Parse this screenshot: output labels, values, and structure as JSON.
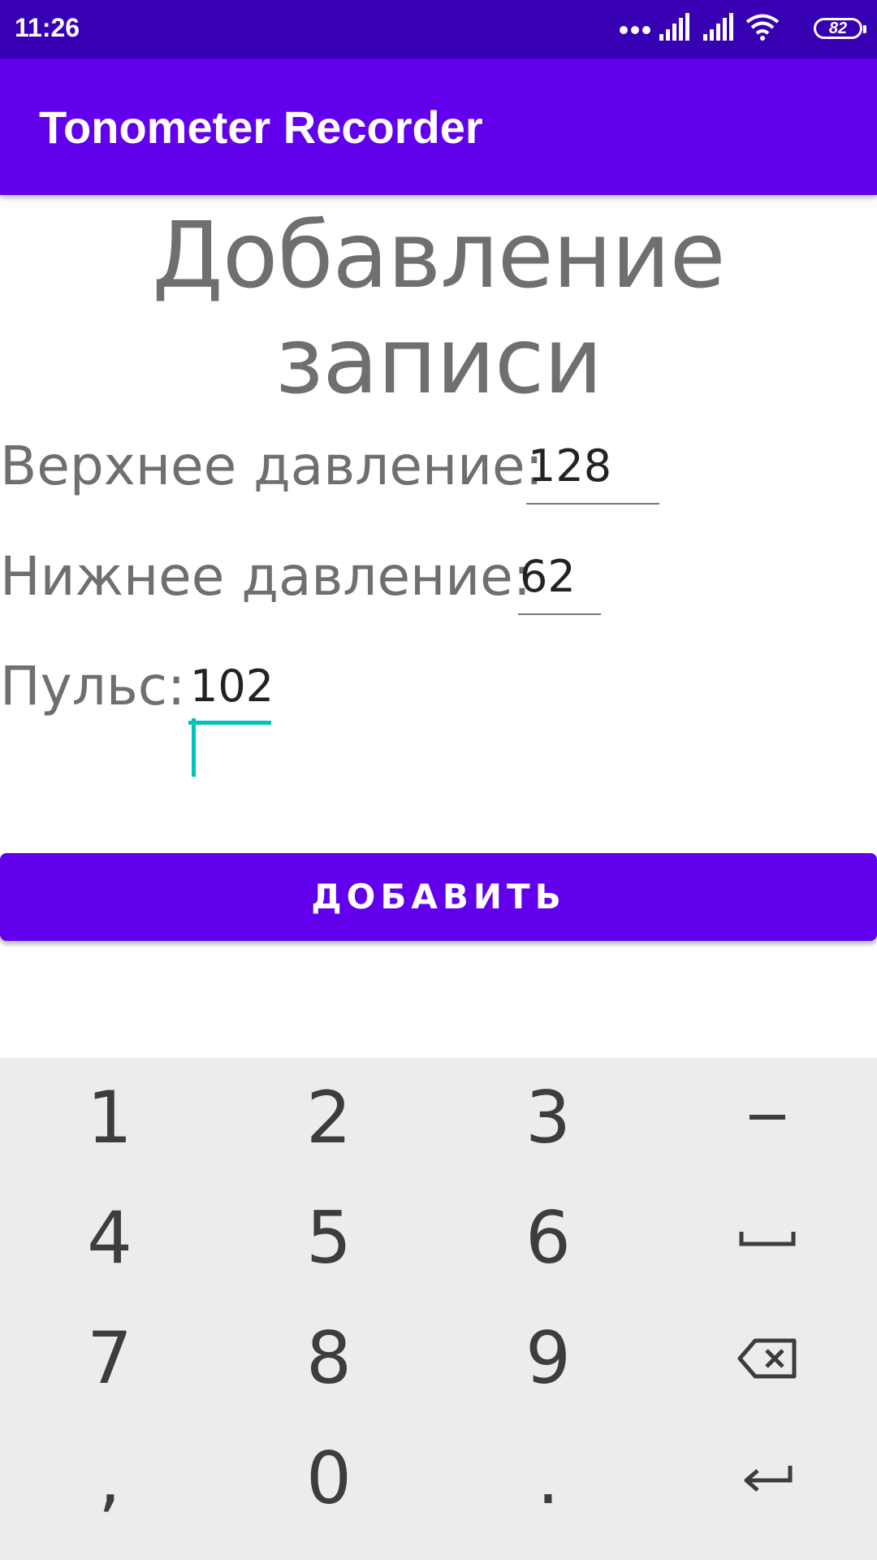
{
  "status_bar": {
    "time": "11:26",
    "battery": "82"
  },
  "app_bar": {
    "title": "Tonometer Recorder"
  },
  "page": {
    "heading": "Добавление записи"
  },
  "form": {
    "upper": {
      "label": "Верхнее давление:",
      "value": "128"
    },
    "lower": {
      "label": "Нижнее давление:",
      "value": "62"
    },
    "pulse": {
      "label": "Пульс:",
      "value": "102"
    },
    "accent_color": "#00c2b8"
  },
  "add_button": {
    "label": "ДОБАВИТЬ",
    "color": "#6200ee"
  },
  "keyboard": {
    "keys": {
      "k1": "1",
      "k2": "2",
      "k3": "3",
      "k4": "4",
      "k5": "5",
      "k6": "6",
      "k7": "7",
      "k8": "8",
      "k9": "9",
      "comma": ",",
      "k0": "0",
      "period": "."
    },
    "icons": [
      "minus-icon",
      "space-icon",
      "backspace-icon",
      "enter-icon"
    ]
  }
}
